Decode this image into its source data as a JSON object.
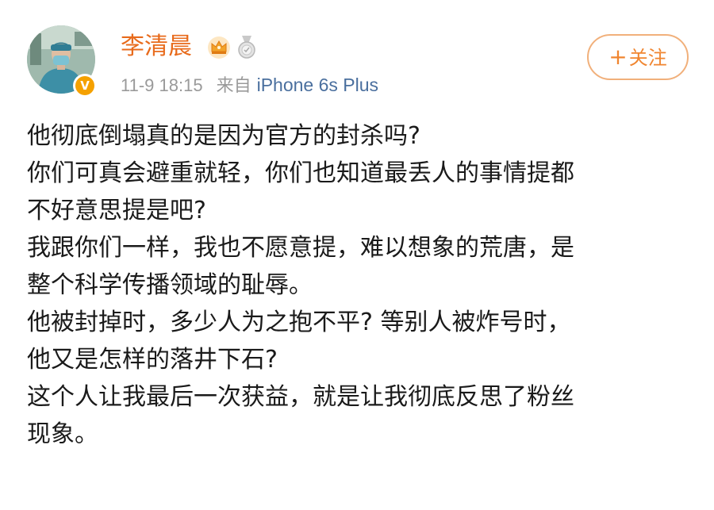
{
  "post": {
    "author": {
      "name": "李清晨",
      "avatar_icon": "avatar-surgeon-photo",
      "verified_icon": "verified-v-icon",
      "verified_glyph": "V",
      "badges": [
        "crown-vip-icon",
        "medal-icon"
      ],
      "name_color": "#e86b1c"
    },
    "time": "11-9 18:15",
    "source_prefix": "来自",
    "source_device": "iPhone 6s Plus",
    "follow": {
      "plus": "+",
      "label": "关注"
    },
    "lines": [
      "他彻底倒塌真的是因为官方的封杀吗?",
      "你们可真会避重就轻，你们也知道最丢人的事情提都",
      "不好意思提是吧?",
      "我跟你们一样，我也不愿意提，难以想象的荒唐，是",
      "整个科学传播领域的耻辱。",
      "他被封掉时，多少人为之抱不平? 等别人被炸号时，",
      "他又是怎样的落井下石?",
      "这个人让我最后一次获益，就是让我彻底反思了粉丝",
      "现象。"
    ]
  },
  "colors": {
    "accent_orange": "#f0852f",
    "link_blue": "#4a6f9e",
    "meta_gray": "#9a9a9a",
    "verified_gold": "#f5a100"
  }
}
